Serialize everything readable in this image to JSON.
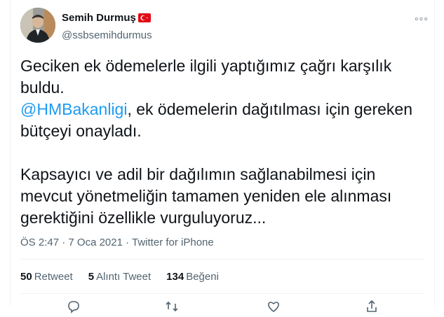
{
  "user": {
    "display_name": "Semih Durmuş",
    "handle": "@ssbsemihdurmus",
    "flag_icon": "turkey-flag-icon"
  },
  "tweet": {
    "line1": "Geciken ek ödemelerle ilgili yaptığımız çağrı karşılık",
    "line2": "buldu.",
    "mention": "@HMBakanligi",
    "line3_rest": ", ek ödemelerin dağıtılması için gereken",
    "line4": "bütçeyi onayladı.",
    "line5": "Kapsayıcı ve adil bir dağılımın sağlanabilmesi için",
    "line6": "mevcut yönetmeliğin tamamen yeniden ele alınması",
    "line7": "gerektiğini özellikle vurguluyoruz..."
  },
  "meta": {
    "time": "ÖS 2:47",
    "sep1": " · ",
    "date": "7 Oca 2021",
    "sep2": " · ",
    "source": "Twitter for iPhone"
  },
  "stats": {
    "retweets_count": "50",
    "retweets_label": "Retweet",
    "quotes_count": "5",
    "quotes_label": "Alıntı Tweet",
    "likes_count": "134",
    "likes_label": "Beğeni"
  },
  "more_glyph": "◦◦◦",
  "colors": {
    "link": "#1d9bf0",
    "text": "#0f1419",
    "secondary": "#536471"
  }
}
